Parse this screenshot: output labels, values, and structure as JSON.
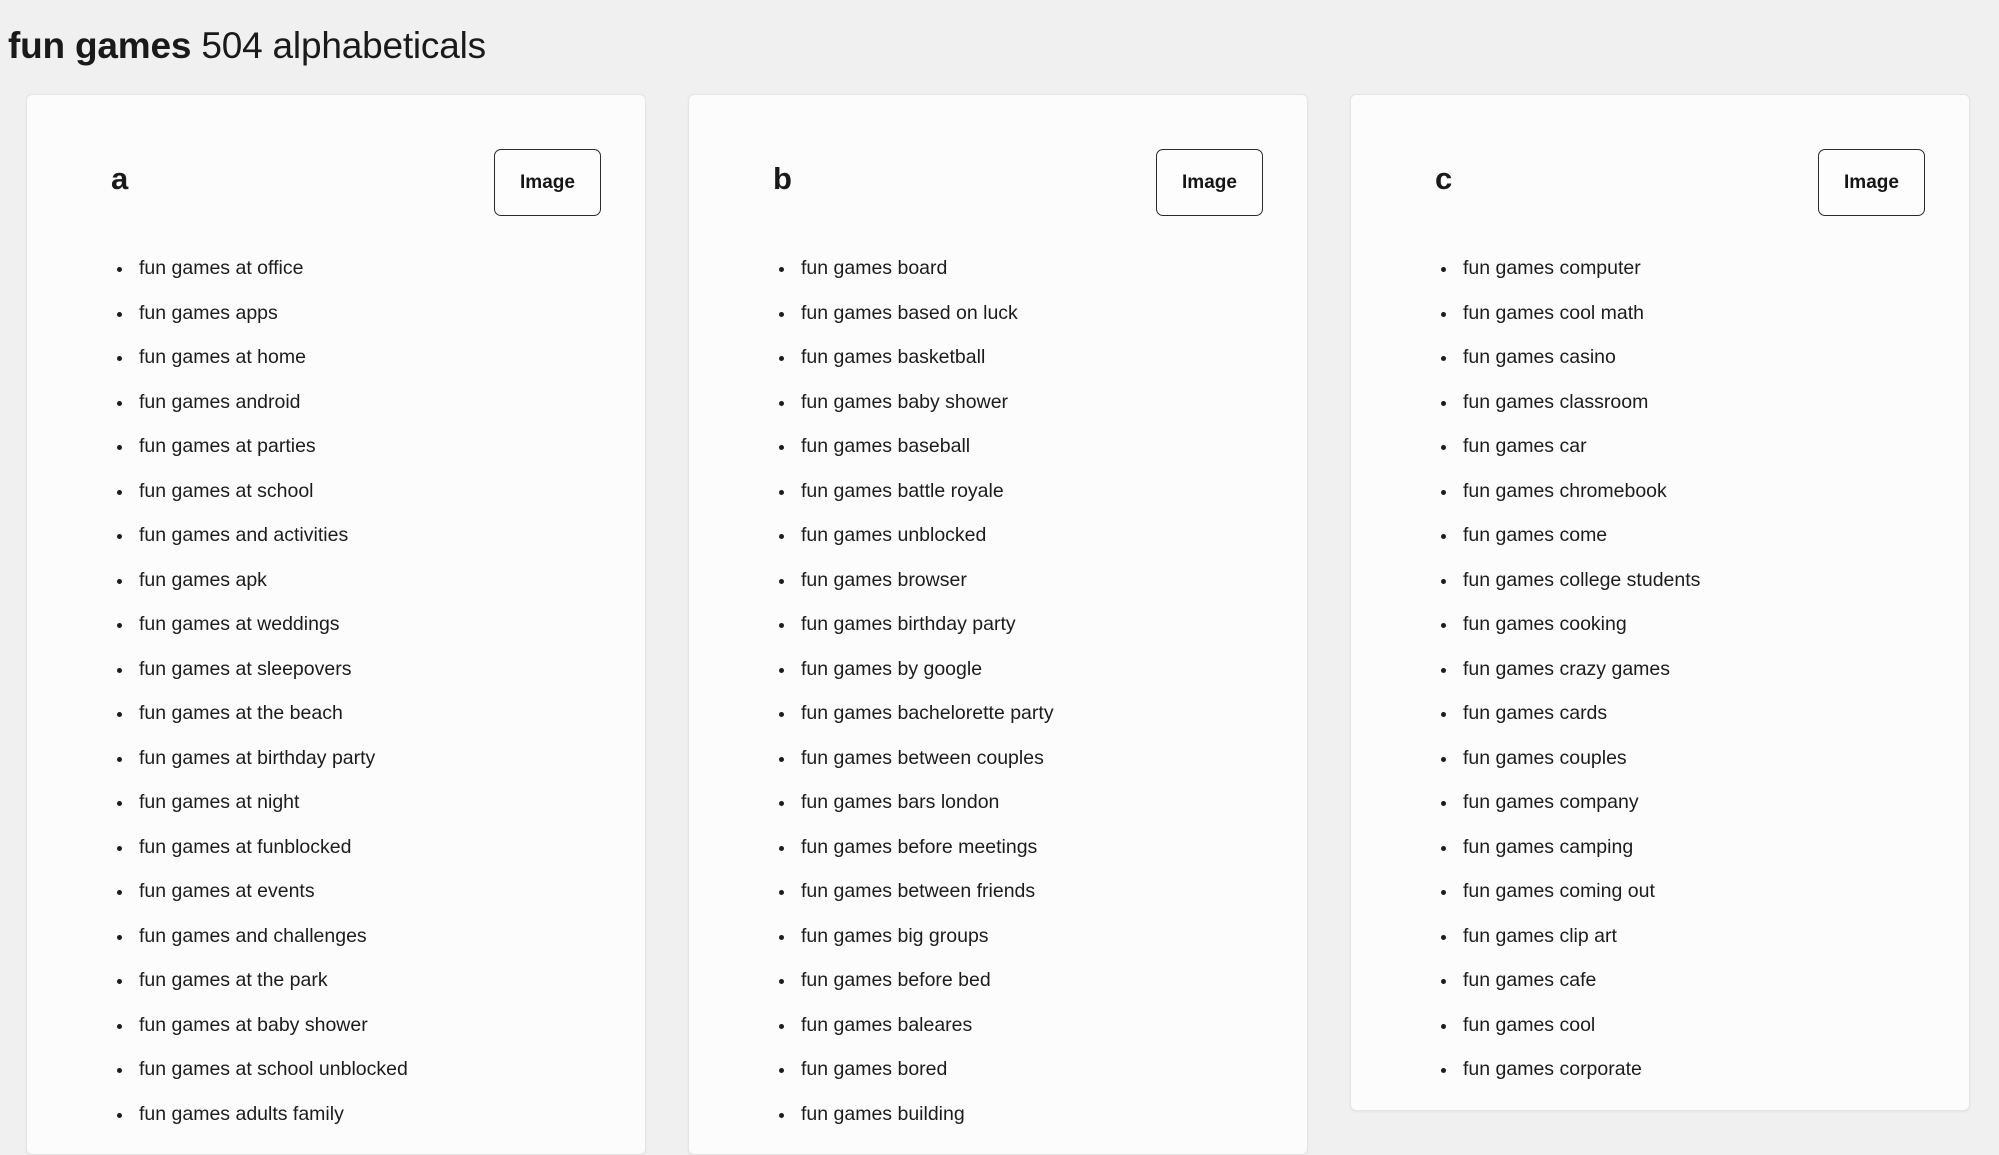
{
  "header": {
    "keyword": "fun games",
    "rest": " 504 alphabeticals"
  },
  "cards": [
    {
      "letter": "a",
      "image_label": "Image",
      "items": [
        "fun games at office",
        "fun games apps",
        "fun games at home",
        "fun games android",
        "fun games at parties",
        "fun games at school",
        "fun games and activities",
        "fun games apk",
        "fun games at weddings",
        "fun games at sleepovers",
        "fun games at the beach",
        "fun games at birthday party",
        "fun games at night",
        "fun games at funblocked",
        "fun games at events",
        "fun games and challenges",
        "fun games at the park",
        "fun games at baby shower",
        "fun games at school unblocked",
        "fun games adults family"
      ]
    },
    {
      "letter": "b",
      "image_label": "Image",
      "items": [
        "fun games board",
        "fun games based on luck",
        "fun games basketball",
        "fun games baby shower",
        "fun games baseball",
        "fun games battle royale",
        "fun games unblocked",
        "fun games browser",
        "fun games birthday party",
        "fun games by google",
        "fun games bachelorette party",
        "fun games between couples",
        "fun games bars london",
        "fun games before meetings",
        "fun games between friends",
        "fun games big groups",
        "fun games before bed",
        "fun games baleares",
        "fun games bored",
        "fun games building"
      ]
    },
    {
      "letter": "c",
      "image_label": "Image",
      "items": [
        "fun games computer",
        "fun games cool math",
        "fun games casino",
        "fun games classroom",
        "fun games car",
        "fun games chromebook",
        "fun games come",
        "fun games college students",
        "fun games cooking",
        "fun games crazy games",
        "fun games cards",
        "fun games couples",
        "fun games company",
        "fun games camping",
        "fun games coming out",
        "fun games clip art",
        "fun games cafe",
        "fun games cool",
        "fun games corporate"
      ]
    }
  ]
}
